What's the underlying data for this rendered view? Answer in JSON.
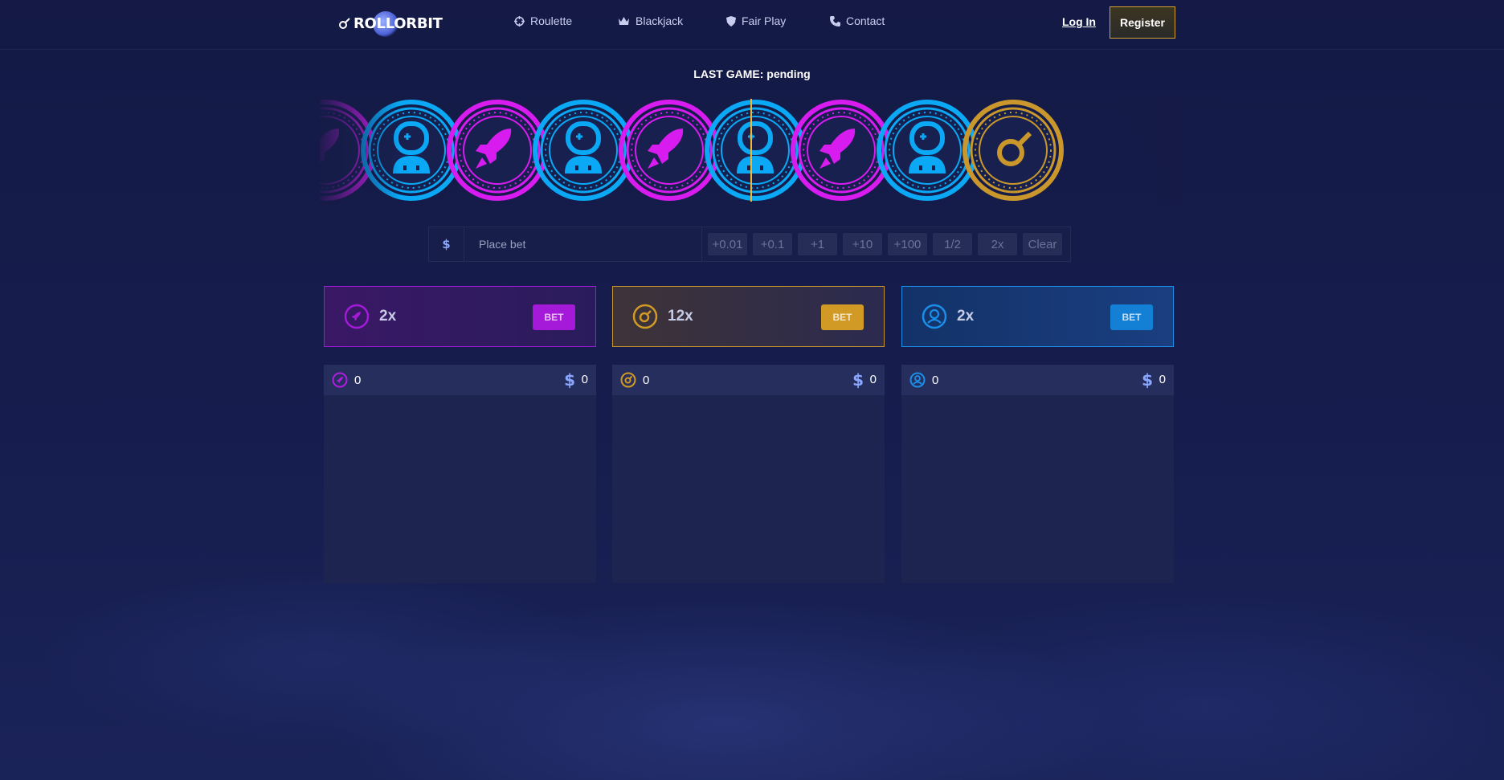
{
  "header": {
    "logo_text": "ROLLORBIT",
    "nav": [
      {
        "label": "Roulette",
        "icon": "crosshair-icon"
      },
      {
        "label": "Blackjack",
        "icon": "crown-icon"
      },
      {
        "label": "Fair Play",
        "icon": "shield-icon"
      },
      {
        "label": "Contact",
        "icon": "phone-icon"
      }
    ],
    "login_label": "Log In",
    "register_label": "Register"
  },
  "last_game": "LAST GAME: pending",
  "reel": {
    "coins": [
      "rocket",
      "astronaut",
      "rocket",
      "astronaut",
      "rocket",
      "astronaut",
      "rocket",
      "astronaut",
      "gold-planet"
    ],
    "colors": {
      "rocket": "#d81cf0",
      "astronaut": "#0aa8f5",
      "gold": "#c9972c",
      "marker": "#f2b733"
    }
  },
  "bet_bar": {
    "currency_symbol": "$",
    "placeholder": "Place bet",
    "chips": [
      "+0.01",
      "+0.1",
      "+1",
      "+10",
      "+100",
      "1/2",
      "2x",
      "Clear"
    ]
  },
  "panels": [
    {
      "key": "rocket",
      "multiplier": "2x",
      "button": "BET",
      "color": "#a519d9"
    },
    {
      "key": "planet",
      "multiplier": "12x",
      "button": "BET",
      "color": "#d19a25"
    },
    {
      "key": "astronaut",
      "multiplier": "2x",
      "button": "BET",
      "color": "#1380d6"
    }
  ],
  "lists": [
    {
      "count": "0",
      "total": "0",
      "currency_symbol": "$"
    },
    {
      "count": "0",
      "total": "0",
      "currency_symbol": "$"
    },
    {
      "count": "0",
      "total": "0",
      "currency_symbol": "$"
    }
  ]
}
